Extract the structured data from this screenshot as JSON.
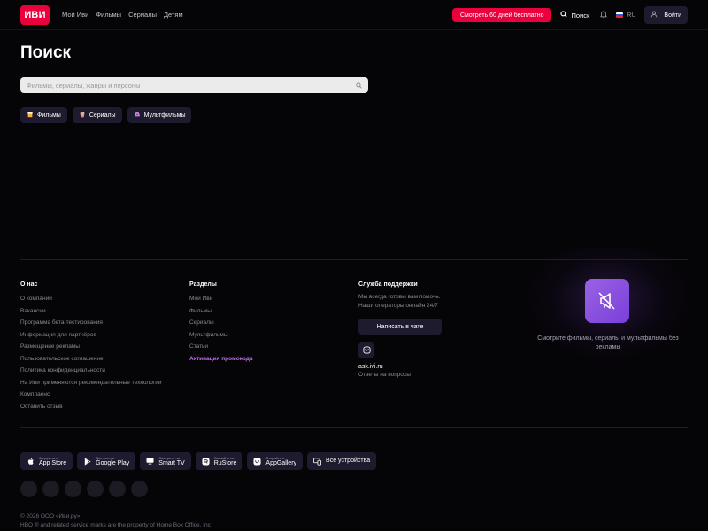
{
  "header": {
    "logo": "ИВИ",
    "nav": [
      "Мой Иви",
      "Фильмы",
      "Сериалы",
      "Детям"
    ],
    "cta_label": "Смотреть 60 дней бесплатно",
    "search_label": "Поиск",
    "lang": "RU",
    "login_label": "Войти"
  },
  "main": {
    "title": "Поиск",
    "search_placeholder": "Фильмы, сериалы, жанры и персоны",
    "chips": [
      {
        "icon": "popcorn-icon",
        "label": "Фильмы"
      },
      {
        "icon": "popcorn-bucket-icon",
        "label": "Сериалы"
      },
      {
        "icon": "cartoon-icon",
        "label": "Мультфильмы"
      }
    ]
  },
  "footer": {
    "about": {
      "heading": "О нас",
      "links": [
        "О компании",
        "Вакансии",
        "Программа бета-тестирования",
        "Информация для партнёров",
        "Размещение рекламы",
        "Пользовательское соглашение",
        "Политика конфиденциальности",
        "На Иви применяются рекомендательные технологии",
        "Комплаенс",
        "Оставить отзыв"
      ]
    },
    "sections": {
      "heading": "Разделы",
      "links": [
        "Мой Иви",
        "Фильмы",
        "Сериалы",
        "Мультфильмы",
        "Статьи"
      ],
      "accent_link": "Активация промокода"
    },
    "support": {
      "heading": "Служба поддержки",
      "line1": "Мы всегда готовы вам помочь.",
      "line2": "Наши операторы онлайн 24/7",
      "chat_label": "Написать в чате",
      "site": "ask.ivi.ru",
      "site_sub": "Ответы на вопросы"
    },
    "promo": {
      "text": "Смотрите фильмы, сериалы и мультфильмы без рекламы"
    },
    "stores": [
      {
        "small": "Загрузить в",
        "big": "App Store",
        "icon": "apple-icon"
      },
      {
        "small": "Доступно в",
        "big": "Google Play",
        "icon": "google-play-icon"
      },
      {
        "small": "Смотрите на",
        "big": "Smart TV",
        "icon": "tv-icon"
      },
      {
        "small": "Скачайте из",
        "big": "RuStore",
        "icon": "rustore-icon"
      },
      {
        "small": "Откройте в",
        "big": "AppGallery",
        "icon": "appgallery-icon"
      },
      {
        "small": "",
        "big": "Все устройства",
        "icon": "devices-icon"
      }
    ],
    "copyright_line1": "© 2026 ООО «Иви.ру»",
    "copyright_line2": "HBO ® and related service marks are the property of Home Box Office, Inc"
  },
  "colors": {
    "accent_red": "#ea003d",
    "button_bg": "#1f1b2e",
    "promo_purple": "#8b50e0",
    "link_accent": "#c56fe6"
  }
}
